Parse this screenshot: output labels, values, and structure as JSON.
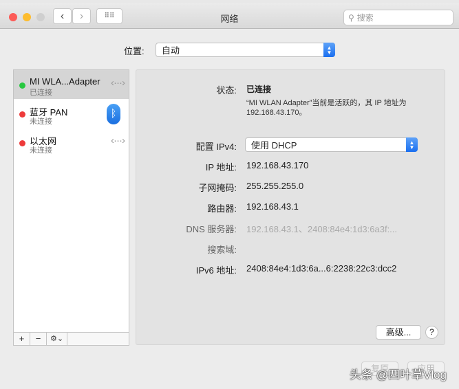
{
  "window": {
    "title": "网络",
    "search_placeholder": "搜索"
  },
  "location": {
    "label": "位置:",
    "value": "自动"
  },
  "services": [
    {
      "name": "MI WLA...Adapter",
      "status": "已连接",
      "color": "#28c840"
    },
    {
      "name": "蓝牙 PAN",
      "status": "未连接",
      "color": "#ee3b3b"
    },
    {
      "name": "以太网",
      "status": "未连接",
      "color": "#ee3b3b"
    }
  ],
  "toolbar": {
    "add": "+",
    "remove": "−",
    "gear": "⚙⌄"
  },
  "details": {
    "status_label": "状态:",
    "status_value": "已连接",
    "status_desc_1": "“MI WLAN Adapter”当前是活跃的，其 IP 地址为",
    "status_desc_2": "192.168.43.170。",
    "ipv4_label": "配置 IPv4:",
    "ipv4_value": "使用 DHCP",
    "ip_label": "IP 地址:",
    "ip_value": "192.168.43.170",
    "mask_label": "子网掩码:",
    "mask_value": "255.255.255.0",
    "router_label": "路由器:",
    "router_value": "192.168.43.1",
    "dns_label": "DNS 服务器:",
    "dns_value": "192.168.43.1、2408:84e4:1d3:6a3f:...",
    "domain_label": "搜索域:",
    "ipv6_label": "IPv6 地址:",
    "ipv6_value": "2408:84e4:1d3:6a...6:2238:22c3:dcc2",
    "advanced": "高级...",
    "help": "?"
  },
  "footer": {
    "revert": "复原",
    "apply": "应用"
  },
  "watermark": "头条 @四叶草Vlog"
}
